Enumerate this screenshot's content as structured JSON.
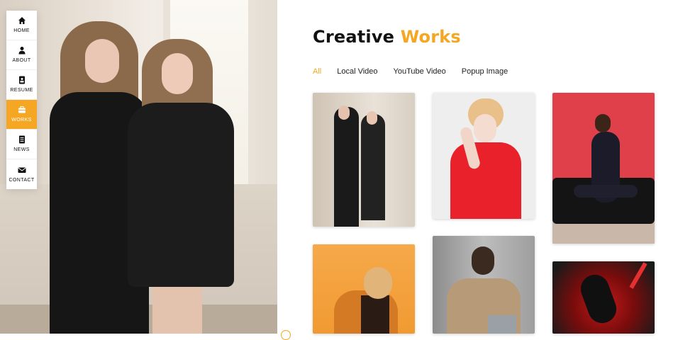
{
  "nav": {
    "items": [
      {
        "label": "HOME",
        "icon": "home-icon",
        "active": false
      },
      {
        "label": "ABOUT",
        "icon": "user-icon",
        "active": false
      },
      {
        "label": "RESUME",
        "icon": "resume-icon",
        "active": false
      },
      {
        "label": "WORKS",
        "icon": "briefcase-icon",
        "active": true
      },
      {
        "label": "NEWS",
        "icon": "news-icon",
        "active": false
      },
      {
        "label": "CONTACT",
        "icon": "envelope-icon",
        "active": false
      }
    ]
  },
  "section": {
    "title_main": "Creative",
    "title_accent": "Works"
  },
  "filters": [
    {
      "label": "All",
      "active": true
    },
    {
      "label": "Local Video",
      "active": false
    },
    {
      "label": "YouTube Video",
      "active": false
    },
    {
      "label": "Popup Image",
      "active": false
    }
  ],
  "portfolio": [
    {
      "name": "portfolio-item-1"
    },
    {
      "name": "portfolio-item-2"
    },
    {
      "name": "portfolio-item-3"
    },
    {
      "name": "portfolio-item-4"
    },
    {
      "name": "portfolio-item-5"
    },
    {
      "name": "portfolio-item-6"
    }
  ],
  "colors": {
    "accent": "#f5a623",
    "text": "#111111"
  }
}
